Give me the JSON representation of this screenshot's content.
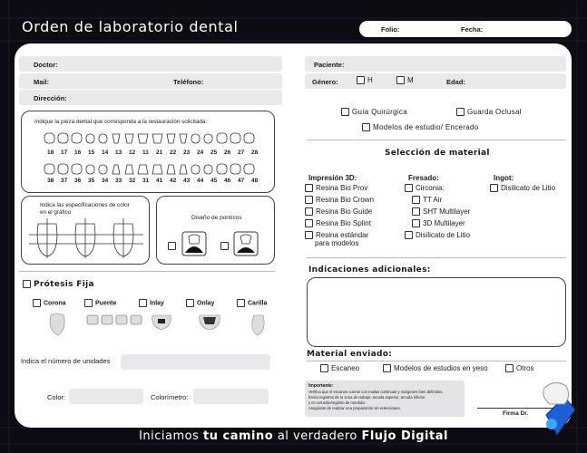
{
  "header": {
    "title": "Orden de laboratorio dental",
    "folio_label": "Folio:",
    "fecha_label": "Fecha:"
  },
  "left": {
    "doctor_label": "Doctor:",
    "mail_label": "Mail:",
    "telefono_label": "Teléfono:",
    "direccion_label": "Dirección:",
    "teeth_instruction": "Indique la pieza dental que corresponda a la restauración solicitada:",
    "upper_teeth": [
      "18",
      "17",
      "16",
      "15",
      "14",
      "13",
      "12",
      "11",
      "21",
      "22",
      "23",
      "24",
      "25",
      "26",
      "27",
      "28"
    ],
    "lower_teeth": [
      "38",
      "37",
      "36",
      "35",
      "34",
      "33",
      "32",
      "31",
      "41",
      "42",
      "43",
      "44",
      "45",
      "46",
      "47",
      "48"
    ],
    "specs_instruction": "Indica las especificaciones de color en el gráfico",
    "pontic_title": "Diseño de pontícos",
    "protesis_label": "Prótesis Fija",
    "prosthesis_types": [
      "Corona",
      "Puente",
      "Inlay",
      "Onlay",
      "Carilla"
    ],
    "unidades_label": "Indica el número de unidades",
    "color_label": "Color:",
    "colorimetro_label": "Colorímetro:"
  },
  "right": {
    "paciente_label": "Paciente:",
    "genero_label": "Género:",
    "genero_options": [
      "H",
      "M"
    ],
    "edad_label": "Edad:",
    "guia_label": "Guía Quirúrgica",
    "guarda_label": "Guarda Oclusal",
    "modelos_label": "Modelos de estudio/ Encerado",
    "seleccion_title": "Selección de material",
    "impresion_title": "Impresión 3D:",
    "impresion_items": [
      "Resina Bio Prov",
      "Resina Bio Crown",
      "Resina Bio Guide",
      "Resina Bio Splint",
      "Resina estándar",
      "para modelos"
    ],
    "fresado_title": "Fresado:",
    "fresado_items": [
      "Circonia:",
      "TT Air",
      "SHT Multilayer",
      "3D Multilayer",
      "Disilicato de Litio"
    ],
    "ingot_title": "Ingot:",
    "ingot_items": [
      "Disilicato de Litio"
    ],
    "indicaciones_title": "Indicaciones adicionales:",
    "material_title": "Material enviado:",
    "material_items": [
      "Escaneo",
      "Modelos de estudios en yeso",
      "Otros"
    ],
    "importante_title": "Importante:",
    "importante_lines": [
      "Verifica que el escaneo cuente con mallas continuas y márgenes bien definidos.",
      "Envía registros de la zona de trabajo: arcada superior, arcada inferior",
      "y en oclusión/registro de mordida.",
      "Asegúrate de realizar una preparación sin retenciones."
    ],
    "firma_label": "Firma Dr."
  },
  "footer": {
    "pre": "Iniciamos",
    "b1": "tu camino",
    "mid": "al verdadero",
    "b2": "Flujo Digital"
  }
}
